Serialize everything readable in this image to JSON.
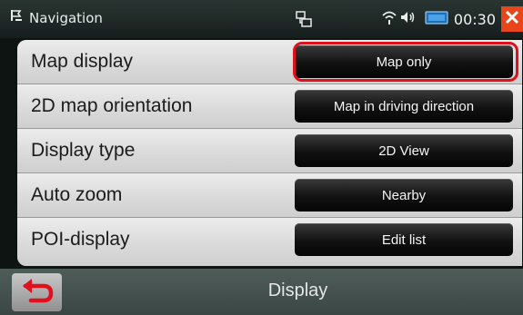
{
  "status_bar": {
    "app_icon": "navigation-app-icon",
    "title": "Navigation",
    "icons": [
      "map-layout-icon",
      "wifi-icon",
      "speaker-icon",
      "display-icon"
    ],
    "time": "00:30",
    "close_icon": "close-icon",
    "close_color": "#e8451b"
  },
  "settings": {
    "rows": [
      {
        "label": "Map display",
        "value": "Map only"
      },
      {
        "label": "2D map orientation",
        "value": "Map in driving direction"
      },
      {
        "label": "Display type",
        "value": "2D View"
      },
      {
        "label": "Auto zoom",
        "value": "Nearby"
      },
      {
        "label": "POI-display",
        "value": "Edit list"
      }
    ],
    "highlighted_row": 0,
    "highlight_color": "#e0101c"
  },
  "bottom_bar": {
    "back_icon": "back-arrow-icon",
    "back_icon_color": "#e0101c",
    "title": "Display"
  }
}
